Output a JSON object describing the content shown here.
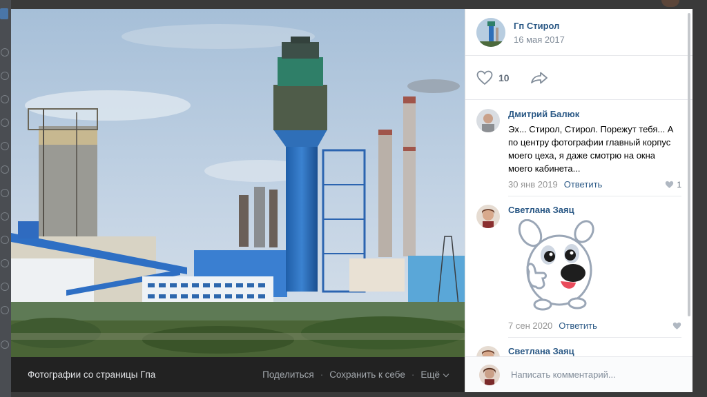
{
  "viewer": {
    "album_title": "Фотографии со страницы Гпа",
    "share_label": "Поделиться",
    "save_label": "Сохранить к себе",
    "more_label": "Ещё",
    "author": {
      "name": "Гп Стирол",
      "date": "16 мая 2017"
    },
    "likes": "10",
    "comments": [
      {
        "name": "Дмитрий Балюк",
        "text": "Эх... Стирол, Стирол. Порежут тебя... А по центру фотографии главный корпус моего цеха, я даже смотрю на окна моего кабинета...",
        "date": "30 янв 2019",
        "reply": "Ответить",
        "likes": "1"
      },
      {
        "name": "Светлана Заяц",
        "text": "",
        "date": "7 сен 2020",
        "reply": "Ответить",
        "likes": ""
      },
      {
        "name": "Светлана Заяц"
      }
    ],
    "compose_placeholder": "Написать комментарий...",
    "colors": {
      "link": "#2a5885",
      "meta": "#818c99",
      "bar": "#222222"
    }
  }
}
